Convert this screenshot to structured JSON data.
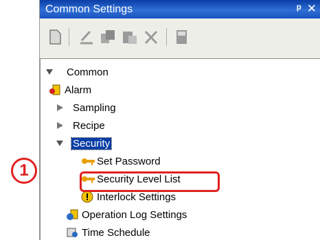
{
  "window": {
    "title": "Common Settings",
    "pin_icon": "pin-icon",
    "close_icon": "close-icon"
  },
  "toolbar": {
    "icons": [
      "new-document-icon",
      "edit-check-icon",
      "copy-icon",
      "paste-icon",
      "delete-icon",
      "properties-icon"
    ]
  },
  "tree": {
    "root": {
      "label": "Common",
      "expanded": true
    },
    "items": [
      {
        "label": "Alarm",
        "icon": "alarm-icon"
      },
      {
        "label": "Sampling",
        "expander": "collapsed"
      },
      {
        "label": "Recipe",
        "expander": "collapsed"
      },
      {
        "label": "Security",
        "expander": "expanded",
        "selected": true
      },
      {
        "label": "Set Password",
        "icon": "key-icon"
      },
      {
        "label": "Security Level List",
        "icon": "key-icon",
        "highlighted": true
      },
      {
        "label": "Interlock Settings",
        "icon": "warning-icon"
      },
      {
        "label": "Operation Log Settings",
        "icon": "operation-log-icon"
      },
      {
        "label": "Time Schedule",
        "icon": "time-schedule-icon"
      }
    ]
  },
  "callout": {
    "number": "1",
    "color": "#e02020"
  },
  "colors": {
    "titlebar": "#0a3ea6",
    "selection": "#0a3ea6",
    "highlight": "#e02020"
  }
}
